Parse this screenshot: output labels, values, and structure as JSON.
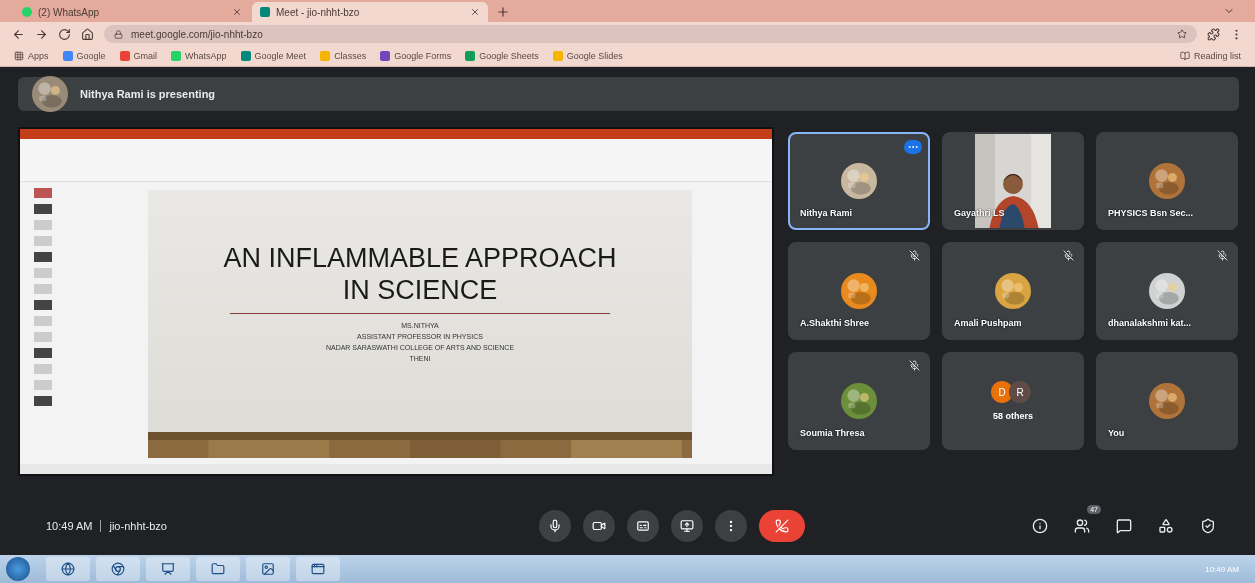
{
  "browser": {
    "tabs": [
      {
        "title": "(2) WhatsApp",
        "selected": false
      },
      {
        "title": "Meet - jio-nhht-bzo",
        "selected": true
      }
    ],
    "url": "meet.google.com/jio-nhht-bzo",
    "bookmarks": [
      {
        "label": "Apps"
      },
      {
        "label": "Google",
        "color": "#4285f4"
      },
      {
        "label": "Gmail",
        "color": "#ea4335"
      },
      {
        "label": "WhatsApp",
        "color": "#25d366"
      },
      {
        "label": "Google Meet",
        "color": "#00897b"
      },
      {
        "label": "Classes",
        "color": "#f4b400"
      },
      {
        "label": "Google Forms",
        "color": "#7248b9"
      },
      {
        "label": "Google Sheets",
        "color": "#0f9d58"
      },
      {
        "label": "Google Slides",
        "color": "#f4b400"
      }
    ],
    "reading_list": "Reading list"
  },
  "meet": {
    "presenting_banner": "Nithya Rami is presenting",
    "slide": {
      "title": "AN INFLAMMABLE APPROACH IN SCIENCE",
      "lines": [
        "MS.NITHYA",
        "ASSISTANT PROFESSOR IN PHYSICS",
        "NADAR SARASWATHI COLLEGE OF ARTS AND SCIENCE",
        "THENI"
      ]
    },
    "tiles": [
      {
        "name": "Nithya Rami",
        "kind": "avatar",
        "color": "#c9b8a0",
        "muted": false,
        "selected": true
      },
      {
        "name": "Gayathri LS",
        "kind": "video",
        "color": "#d8d6d2",
        "muted": false,
        "selected": false
      },
      {
        "name": "PHYSICS Bsn Sec...",
        "kind": "avatar",
        "color": "#b0743a",
        "muted": false,
        "selected": false
      },
      {
        "name": "A.Shakthi Shree",
        "kind": "avatar",
        "color": "#e88a1e",
        "muted": true,
        "selected": false
      },
      {
        "name": "Amali Pushpam",
        "kind": "avatar",
        "color": "#d9a441",
        "muted": true,
        "selected": false
      },
      {
        "name": "dhanalakshmi kat...",
        "kind": "avatar",
        "color": "#cfd2d0",
        "muted": true,
        "selected": false
      },
      {
        "name": "Soumia Thresa",
        "kind": "avatar",
        "color": "#6b8f3a",
        "muted": true,
        "selected": false
      },
      {
        "name": "58 others",
        "kind": "others",
        "initials": [
          "D",
          "R"
        ],
        "muted": false,
        "selected": false
      },
      {
        "name": "You",
        "kind": "avatar",
        "color": "#b0743a",
        "muted": false,
        "selected": false
      }
    ],
    "time": "10:49 AM",
    "meeting_code": "jio-nhht-bzo",
    "controls": [
      {
        "kind": "mic"
      },
      {
        "kind": "camera"
      },
      {
        "kind": "captions"
      },
      {
        "kind": "present"
      },
      {
        "kind": "more"
      },
      {
        "kind": "hangup"
      }
    ],
    "side_controls": [
      {
        "kind": "info"
      },
      {
        "kind": "people",
        "badge": "47"
      },
      {
        "kind": "chat"
      },
      {
        "kind": "activities"
      },
      {
        "kind": "host"
      }
    ]
  },
  "taskbar": {
    "apps": [
      {
        "kind": "ie"
      },
      {
        "kind": "chrome"
      },
      {
        "kind": "powerpoint"
      },
      {
        "kind": "folder"
      },
      {
        "kind": "photos"
      },
      {
        "kind": "window"
      }
    ],
    "clock": "10:49 AM"
  }
}
